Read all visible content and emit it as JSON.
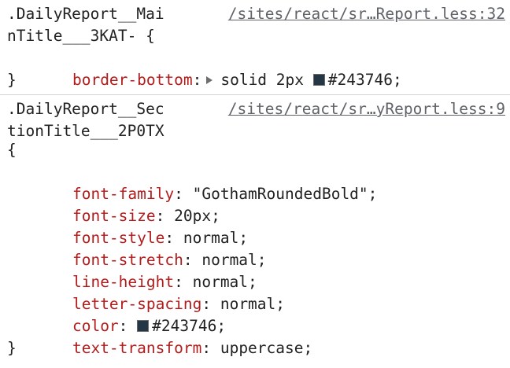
{
  "rules": [
    {
      "selector_line1": ".DailyReport__Mai",
      "selector_line2": "nTitle___3KAT- {",
      "source": "/sites/react/sr…Report.less:32",
      "close_brace": "}",
      "declarations": [
        {
          "property": "border-bottom",
          "colon": ":",
          "value_prefix": "solid 2px ",
          "value": "#243746",
          "semicolon": ";",
          "swatch_color": "#243746",
          "expandable": true
        }
      ]
    },
    {
      "selector_line1": ".DailyReport__Sec",
      "selector_line2": "tionTitle___2P0TX",
      "open_brace": "{",
      "source": "/sites/react/sr…yReport.less:9",
      "close_brace": "}",
      "declarations": [
        {
          "property": "font-family",
          "colon": ":",
          "value": " \"GothamRoundedBold\"",
          "semicolon": ";"
        },
        {
          "property": "font-size",
          "colon": ":",
          "value": " 20px",
          "semicolon": ";"
        },
        {
          "property": "font-style",
          "colon": ":",
          "value": " normal",
          "semicolon": ";"
        },
        {
          "property": "font-stretch",
          "colon": ":",
          "value": " normal",
          "semicolon": ";"
        },
        {
          "property": "line-height",
          "colon": ":",
          "value": " normal",
          "semicolon": ";"
        },
        {
          "property": "letter-spacing",
          "colon": ":",
          "value": " normal",
          "semicolon": ";"
        },
        {
          "property": "color",
          "colon": ":",
          "value": "#243746",
          "semicolon": ";",
          "swatch_color": "#243746"
        },
        {
          "property": "text-transform",
          "colon": ":",
          "value": " uppercase",
          "semicolon": ";"
        }
      ]
    }
  ]
}
